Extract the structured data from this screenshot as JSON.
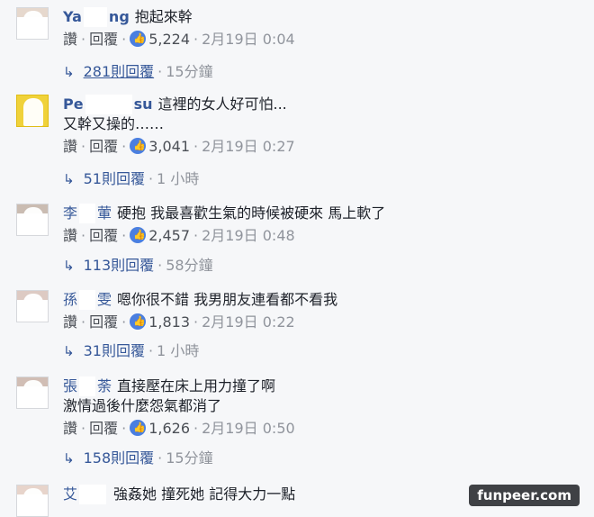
{
  "comments": [
    {
      "author_start": "Ya",
      "author_end": "ng",
      "text": "抱起來幹",
      "text_line2": "",
      "actions": {
        "like": "讚",
        "reply": "回覆"
      },
      "likes": "5,224",
      "timestamp": "2月19日 0:04",
      "replies": {
        "count": "281則回覆",
        "time": "15分鐘"
      }
    },
    {
      "author_start": "Pe",
      "author_end": "su",
      "text": "這裡的女人好可怕...",
      "text_line2": "又幹又操的……",
      "actions": {
        "like": "讚",
        "reply": "回覆"
      },
      "likes": "3,041",
      "timestamp": "2月19日 0:27",
      "replies": {
        "count": "51則回覆",
        "time": "1 小時"
      }
    },
    {
      "author_start": "李",
      "author_end": "葷",
      "text": "硬抱 我最喜歡生氣的時候被硬來 馬上軟了",
      "text_line2": "",
      "actions": {
        "like": "讚",
        "reply": "回覆"
      },
      "likes": "2,457",
      "timestamp": "2月19日 0:48",
      "replies": {
        "count": "113則回覆",
        "time": "58分鐘"
      }
    },
    {
      "author_start": "孫",
      "author_end": "雯",
      "text": "嗯你很不錯 我男朋友連看都不看我",
      "text_line2": "",
      "actions": {
        "like": "讚",
        "reply": "回覆"
      },
      "likes": "1,813",
      "timestamp": "2月19日 0:22",
      "replies": {
        "count": "31則回覆",
        "time": "1 小時"
      }
    },
    {
      "author_start": "張",
      "author_end": "荼",
      "text": "直接壓在床上用力撞了啊",
      "text_line2": "激情過後什麼怨氣都消了",
      "actions": {
        "like": "讚",
        "reply": "回覆"
      },
      "likes": "1,626",
      "timestamp": "2月19日 0:50",
      "replies": {
        "count": "158則回覆",
        "time": "15分鐘"
      }
    },
    {
      "author_start": "艾",
      "author_end": "",
      "text": "強姦她 撞死她 記得大力一點"
    }
  ],
  "watermark": "funpeer.com",
  "colors": {
    "background": "#f6f7f9",
    "author_link": "#365899",
    "like_badge": "#4a7fe0",
    "muted": "#90949c"
  },
  "icons": {
    "like_badge": "thumbs-up-icon",
    "reply_arrow": "reply-arrow-icon"
  }
}
